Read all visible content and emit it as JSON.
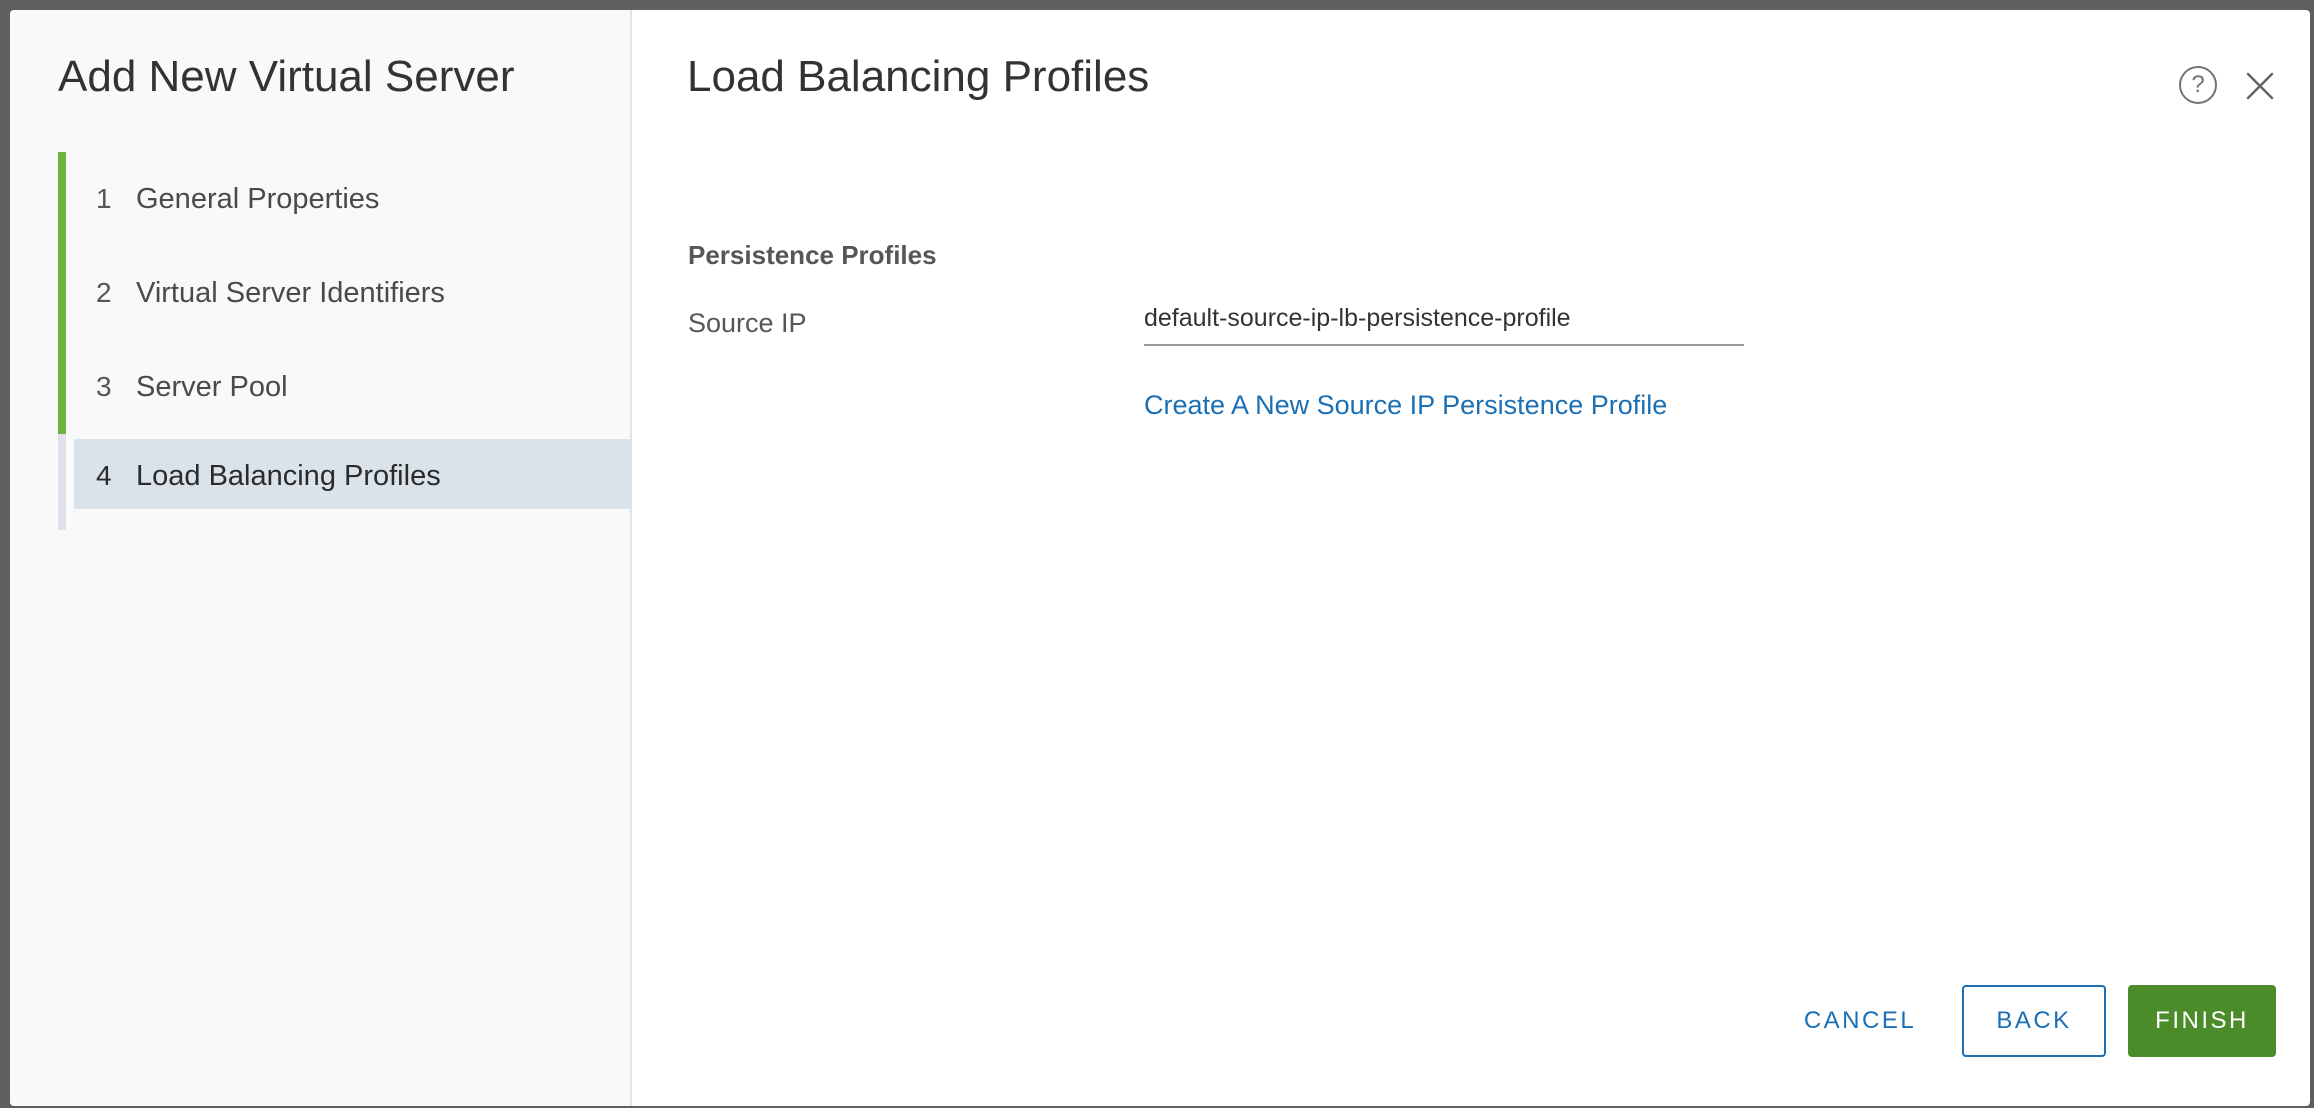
{
  "wizard": {
    "title": "Add New Virtual Server",
    "steps": [
      {
        "number": "1",
        "label": "General Properties",
        "state": "done"
      },
      {
        "number": "2",
        "label": "Virtual Server Identifiers",
        "state": "done"
      },
      {
        "number": "3",
        "label": "Server Pool",
        "state": "done"
      },
      {
        "number": "4",
        "label": "Load Balancing Profiles",
        "state": "current"
      }
    ]
  },
  "page": {
    "title": "Load Balancing Profiles",
    "help_icon": "help-icon",
    "close_icon": "close-icon"
  },
  "persistence": {
    "section_title": "Persistence Profiles",
    "source_ip_label": "Source IP",
    "source_ip_value": "default-source-ip-lb-persistence-profile",
    "create_link": "Create A New Source IP Persistence Profile"
  },
  "footer": {
    "cancel_label": "CANCEL",
    "back_label": "BACK",
    "finish_label": "FINISH"
  },
  "colors": {
    "step_done": "#6fb43f",
    "step_current_bg": "#dbe3ea",
    "link": "#1b6fb5",
    "finish_button": "#4b8b2a"
  }
}
